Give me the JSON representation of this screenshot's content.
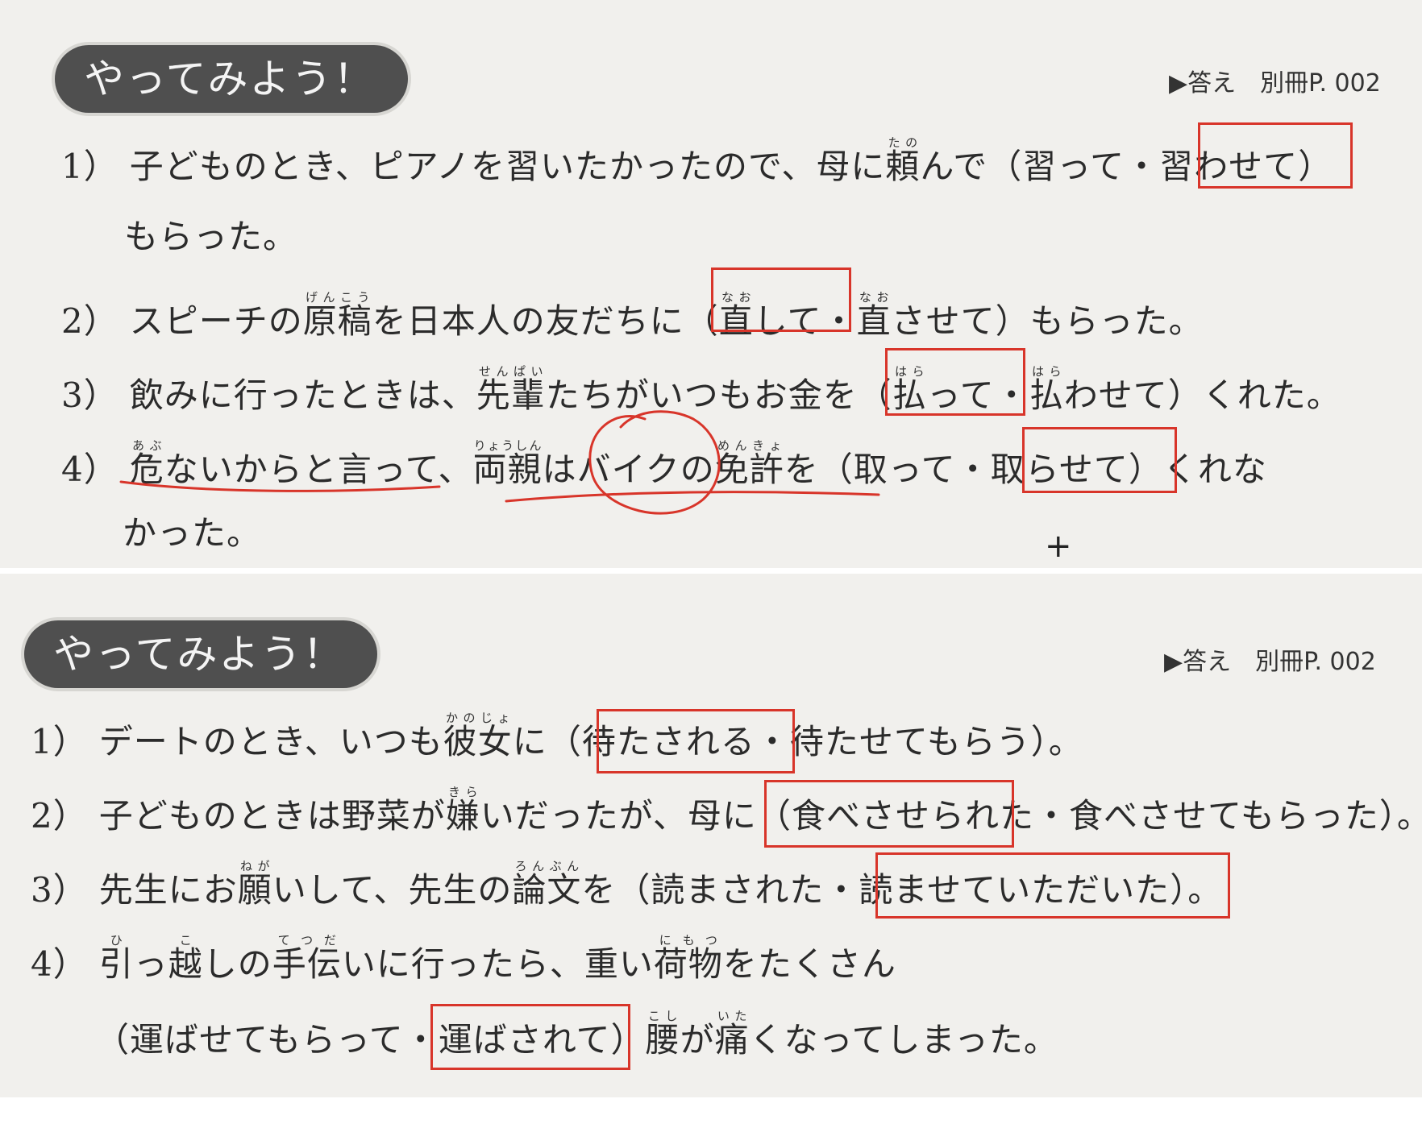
{
  "badge_label": "やってみよう！",
  "answer_ref": "▶答え　別冊P. 002",
  "exercise1": {
    "q1": {
      "num": "1）",
      "a": "子どものとき、ピアノを習いたかったので、母に",
      "ruby1_base": "頼",
      "ruby1_rt": "たの",
      "b": "んで（習って・",
      "c": "習わせて",
      "d": "）",
      "e": "もらった。"
    },
    "q2": {
      "num": "2）",
      "a": "スピーチの",
      "ruby1_base": "原稿",
      "ruby1_rt": "げんこう",
      "b": "を日本人の友だちに（",
      "ruby2_base": "直",
      "ruby2_rt": "なお",
      "c": "して",
      "d": "・",
      "ruby3_base": "直",
      "ruby3_rt": "なお",
      "e": "させて）もらった。"
    },
    "q3": {
      "num": "3）",
      "a": "飲みに行ったときは、",
      "ruby1_base": "先輩",
      "ruby1_rt": "せんぱい",
      "b": "たちがいつもお金を（",
      "ruby2_base": "払",
      "ruby2_rt": "はら",
      "c": "って",
      "d": "・",
      "ruby3_base": "払",
      "ruby3_rt": "はら",
      "e": "わせて）くれた。"
    },
    "q4": {
      "num": "4）",
      "ruby1_base": "危",
      "ruby1_rt": "あぶ",
      "a": "ないからと言って、",
      "ruby2_base": "両親",
      "ruby2_rt": "りょうしん",
      "b": "はバイクの",
      "ruby3_base": "免許",
      "ruby3_rt": "めんきょ",
      "c": "を（取って・",
      "d": "取らせて",
      "e": "）くれな",
      "f": "かった。"
    }
  },
  "exercise2": {
    "q1": {
      "num": "1）",
      "a": "デートのとき、いつも",
      "ruby1_base": "彼女",
      "ruby1_rt": "かのじょ",
      "b": "に（",
      "c": "待たされる",
      "d": "・待たせてもらう）。"
    },
    "q2": {
      "num": "2）",
      "a": "子どものときは野菜が",
      "ruby1_base": "嫌",
      "ruby1_rt": "きら",
      "b": "いだったが、母に（",
      "c": "食べさせられた",
      "d": "・食べさせてもらった）。"
    },
    "q3": {
      "num": "3）",
      "a": "先生にお",
      "ruby1_base": "願",
      "ruby1_rt": "ねが",
      "b": "いして、先生の",
      "ruby2_base": "論文",
      "ruby2_rt": "ろんぶん",
      "c": "を（読まされた・",
      "d": "読ませていただいた",
      "e": "）。"
    },
    "q4": {
      "num": "4）",
      "ruby1_base": "引",
      "ruby1_rt": "ひ",
      "a": "っ",
      "ruby2_base": "越",
      "ruby2_rt": "こ",
      "b": "しの",
      "ruby3_base": "手伝",
      "ruby3_rt": "てつだ",
      "c": "いに行ったら、重い",
      "ruby4_base": "荷物",
      "ruby4_rt": "にもつ",
      "d": "をたくさん",
      "e": "（運ばせてもらって・",
      "f": "運ばされて",
      "g": "）",
      "ruby5_base": "腰",
      "ruby5_rt": "こし",
      "h": "が",
      "ruby6_base": "痛",
      "ruby6_rt": "いた",
      "i": "くなってしまった。"
    }
  },
  "colors": {
    "annotation_red": "#d8352a",
    "badge_bg": "#4f4f4f",
    "paper": "#f1f0ed"
  }
}
